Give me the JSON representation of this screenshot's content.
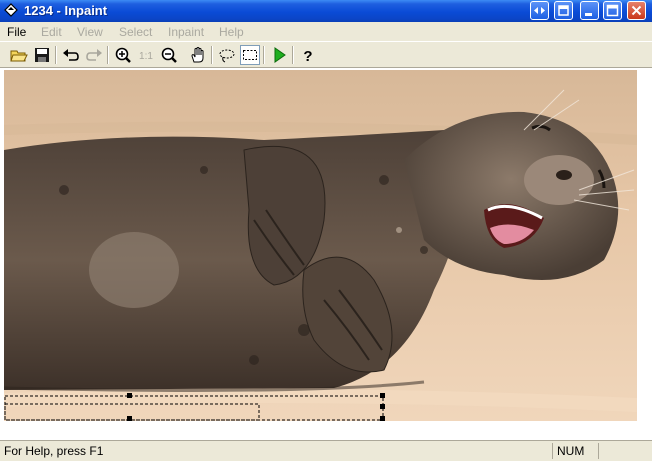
{
  "window": {
    "title": "1234 - Inpaint"
  },
  "menu": {
    "items": [
      {
        "label": "File",
        "enabled": true
      },
      {
        "label": "Edit",
        "enabled": false
      },
      {
        "label": "View",
        "enabled": false
      },
      {
        "label": "Select",
        "enabled": false
      },
      {
        "label": "Inpaint",
        "enabled": false
      },
      {
        "label": "Help",
        "enabled": false
      }
    ]
  },
  "toolbar": {
    "tools": [
      {
        "name": "open-icon"
      },
      {
        "name": "save-icon"
      },
      {
        "name": "undo-icon"
      },
      {
        "name": "redo-icon"
      },
      {
        "name": "zoom-in-icon"
      },
      {
        "name": "actual-size-icon"
      },
      {
        "name": "zoom-out-icon"
      },
      {
        "name": "hand-icon"
      },
      {
        "name": "lasso-icon"
      },
      {
        "name": "rect-select-icon"
      },
      {
        "name": "run-icon"
      },
      {
        "name": "help-icon"
      }
    ]
  },
  "colors": {
    "titlebar": "#0a4bd6",
    "run_green": "#1fae1f",
    "photo_background": "#e7c9a8"
  },
  "statusbar": {
    "help_text": "For Help, press F1",
    "num_indicator": "NUM"
  }
}
